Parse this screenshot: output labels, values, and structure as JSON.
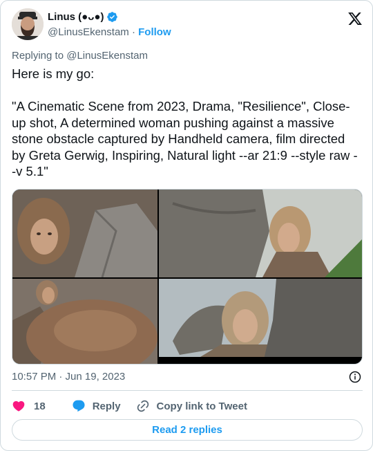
{
  "author": {
    "display_name": "Linus (●ᴗ●)",
    "handle": "@LinusEkenstam",
    "separator": " · ",
    "follow_label": "Follow",
    "verified": true
  },
  "tweet": {
    "replying_prefix": "Replying to ",
    "replying_to": "@LinusEkenstam",
    "text": "Here is my go:\n\n\"A Cinematic Scene from 2023, Drama, \"Resilience\", Close-up shot, A determined woman pushing against a massive stone obstacle captured by Handheld camera, film directed by Greta Gerwig, Inspiring, Natural light --ar 21:9 --style raw --v 5.1\"",
    "timestamp": "10:57 PM · Jun 19, 2023"
  },
  "actions": {
    "like_count": "18",
    "reply_label": "Reply",
    "copy_link_label": "Copy link to Tweet"
  },
  "read_replies_label": "Read 2 replies",
  "colors": {
    "accent": "#1d9bf0",
    "like": "#f91880",
    "text": "#0f1419",
    "muted": "#536471",
    "border": "#cfd9de"
  },
  "icons": [
    "x-logo-icon",
    "verified-badge-icon",
    "info-icon",
    "heart-icon",
    "reply-bubble-icon",
    "link-icon"
  ]
}
